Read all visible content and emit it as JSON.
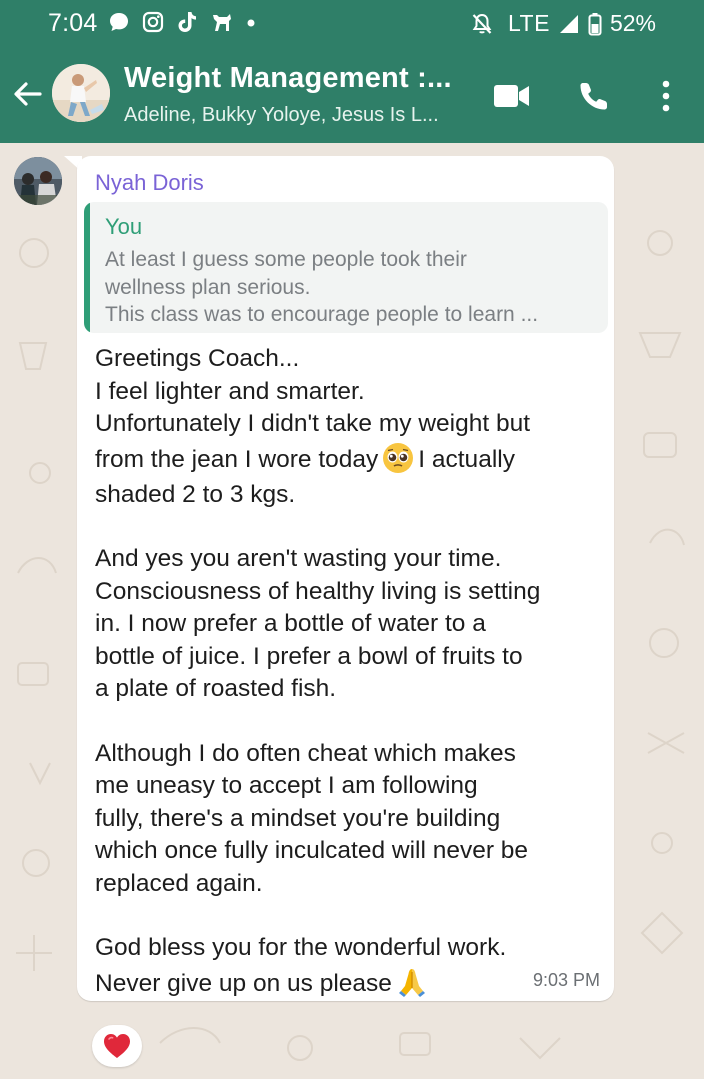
{
  "status_bar": {
    "time": "7:04",
    "network": "LTE",
    "battery": "52%"
  },
  "header": {
    "title": "Weight Management :...",
    "subtitle": "Adeline, Bukky Yoloye, Jesus Is L...",
    "icons": [
      "back-arrow-icon",
      "video-call-icon",
      "phone-icon",
      "more-options-icon"
    ]
  },
  "message": {
    "sender": "Nyah Doris",
    "sender_color": "#7a63d6",
    "quote": {
      "author": "You",
      "lines": [
        "At least I guess some people took their",
        "wellness plan serious.",
        "This class was to encourage people to learn ..."
      ]
    },
    "body": {
      "p1_l1": "Greetings Coach...",
      "p1_l2": "I feel lighter and smarter.",
      "p1_l3": "Unfortunately I didn't take my weight but",
      "p1_l4a": "from the jean I wore today",
      "p1_l4b": "I actually",
      "p1_l5": "shaded 2 to 3 kgs.",
      "p2_l1": "And yes you aren't wasting your time.",
      "p2_l2": "Consciousness of healthy living is setting",
      "p2_l3": "in. I now prefer a bottle of water to a",
      "p2_l4": "bottle of juice. I prefer a bowl of fruits to",
      "p2_l5": "a plate of roasted fish.",
      "p3_l1": "Although I do often cheat which makes",
      "p3_l2": "me uneasy to accept I am following",
      "p3_l3": "fully, there's a mindset you're building",
      "p3_l4": "which once fully inculcated will never be",
      "p3_l5": "replaced again.",
      "p4_l1": "God bless you for the wonderful work.",
      "p4_l2": "Never give up on us please"
    },
    "time": "9:03 PM",
    "reaction": "heart"
  },
  "colors": {
    "header_bg": "#2f7f68",
    "quote_accent": "#2f9e77",
    "chat_bg": "#ece5dd"
  }
}
